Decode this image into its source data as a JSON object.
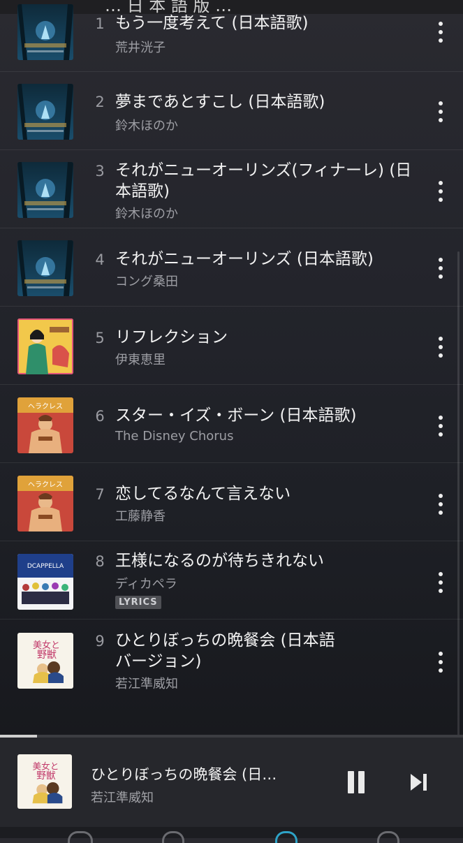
{
  "header": {
    "partial_title": "… 日 本 語 版 …"
  },
  "tracks": [
    {
      "number": "1",
      "title": "もう一度考えて (日本語歌)",
      "artist": "荒井洸子",
      "art": "princess-frog"
    },
    {
      "number": "2",
      "title": "夢まであとすこし (日本語歌)",
      "artist": "鈴木ほのか",
      "art": "princess-frog"
    },
    {
      "number": "3",
      "title": "それがニューオーリンズ(フィナーレ) (日本語歌)",
      "artist": "鈴木ほのか",
      "art": "princess-frog"
    },
    {
      "number": "4",
      "title": "それがニューオーリンズ (日本語歌)",
      "artist": "コング桑田",
      "art": "princess-frog"
    },
    {
      "number": "5",
      "title": "リフレクション",
      "artist": "伊東恵里",
      "art": "mulan"
    },
    {
      "number": "6",
      "title": "スター・イズ・ボーン (日本語歌)",
      "artist": "The Disney Chorus",
      "art": "hercules"
    },
    {
      "number": "7",
      "title": "恋してるなんて言えない",
      "artist": "工藤静香",
      "art": "hercules"
    },
    {
      "number": "8",
      "title": "王様になるのが待ちきれない",
      "artist": "ディカペラ",
      "art": "dcappella",
      "badge": "LYRICS"
    },
    {
      "number": "9",
      "title": "ひとりぼっちの晩餐会 (日本語バージョン)",
      "artist": "若江準威知",
      "art": "beauty-beast"
    }
  ],
  "now_playing": {
    "title": "ひとりぼっちの晩餐会 (日…",
    "artist": "若江準威知",
    "progress": 0.08
  },
  "icons": {
    "more": "more-vertical-icon",
    "pause": "pause-icon",
    "next": "skip-next-icon"
  }
}
